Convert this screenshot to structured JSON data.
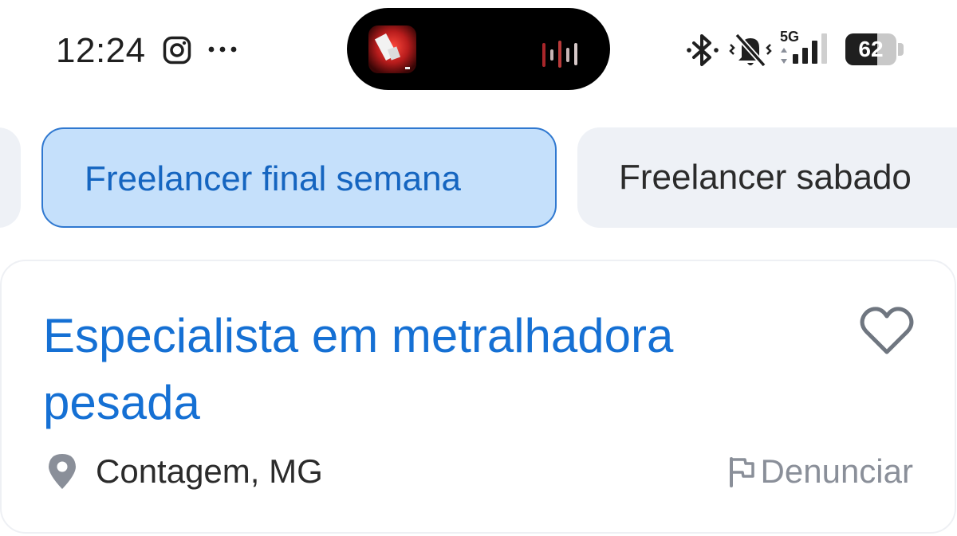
{
  "status_bar": {
    "time": "12:24",
    "network": "5G",
    "battery_level": 62,
    "battery_label": "62",
    "icons": [
      "instagram-icon",
      "more-dots-icon",
      "bluetooth-icon",
      "ringer-muted-icon",
      "signal-icon",
      "battery-icon"
    ]
  },
  "dynamic_island": {
    "icons": [
      "now-playing-artwork",
      "audio-waveform-icon"
    ],
    "accent_color": "#c62828"
  },
  "filters": {
    "chips": [
      {
        "label": "",
        "active": false
      },
      {
        "label": "Freelancer final semana",
        "active": true
      },
      {
        "label": "Freelancer sabado",
        "active": false
      }
    ]
  },
  "job_card": {
    "title": "Especialista em metralhadora pesada",
    "location": "Contagem, MG",
    "report_label": "Denunciar",
    "favorite_icon": "heart-outline-icon",
    "location_icon": "map-pin-icon",
    "report_icon": "flag-icon"
  },
  "colors": {
    "accent": "#1570d4",
    "chip_active_bg": "#c5e0fb",
    "chip_active_border": "#2f78d0",
    "chip_inactive_bg": "#eef1f6",
    "muted_text": "#8a8f99"
  }
}
